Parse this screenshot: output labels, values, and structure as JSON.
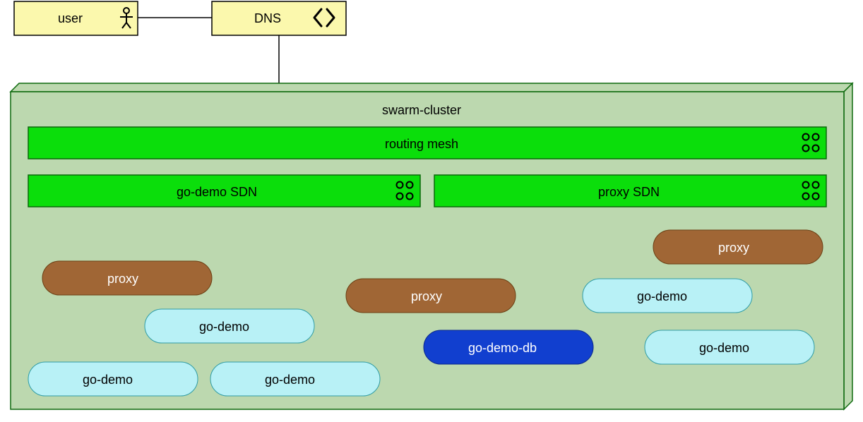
{
  "nodes": {
    "user": {
      "label": "user"
    },
    "dns": {
      "label": "DNS"
    },
    "cluster": {
      "label": "swarm-cluster"
    },
    "routing_mesh": {
      "label": "routing mesh"
    },
    "go_demo_sdn": {
      "label": "go-demo SDN"
    },
    "proxy_sdn": {
      "label": "proxy SDN"
    },
    "proxy_1": {
      "label": "proxy"
    },
    "proxy_2": {
      "label": "proxy"
    },
    "proxy_3": {
      "label": "proxy"
    },
    "go_demo_1": {
      "label": "go-demo"
    },
    "go_demo_2": {
      "label": "go-demo"
    },
    "go_demo_3": {
      "label": "go-demo"
    },
    "go_demo_4": {
      "label": "go-demo"
    },
    "go_demo_5": {
      "label": "go-demo"
    },
    "go_demo_db": {
      "label": "go-demo-db"
    }
  },
  "colors": {
    "yellow": "#fbf8ad",
    "container_green": "#bcd8af",
    "bright_green": "#0bde0b",
    "brown": "#a06635",
    "cyan": "#b8f1f6",
    "blue": "#113fcf"
  }
}
